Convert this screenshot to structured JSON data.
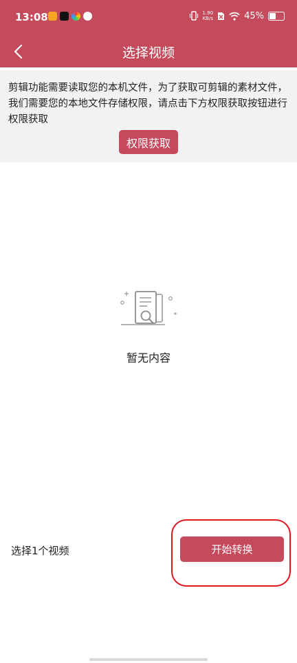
{
  "status_bar": {
    "time": "13:08",
    "speed_value": "1.90",
    "speed_unit": "KB/s",
    "battery": "45%"
  },
  "header": {
    "title": "选择视频"
  },
  "permission": {
    "message": "剪辑功能需要读取您的本机文件，为了获取可剪辑的素材文件，我们需要您的本地文件存储权限，请点击下方权限获取按钮进行权限获取",
    "button_label": "权限获取"
  },
  "empty_state": {
    "text": "暂无内容"
  },
  "footer": {
    "selected_label": "选择1个视频",
    "start_button": "开始转换"
  },
  "colors": {
    "accent": "#c44a5c",
    "highlight": "#e0161d"
  }
}
